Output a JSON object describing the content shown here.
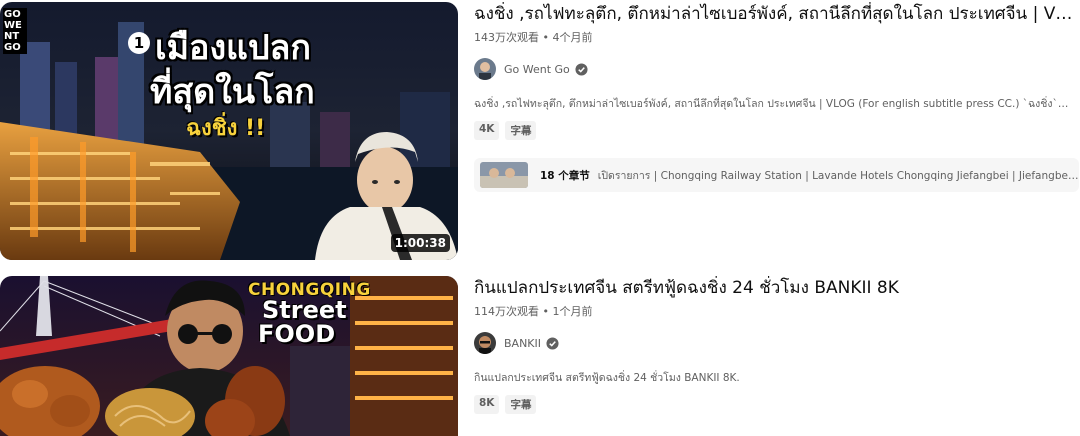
{
  "results": [
    {
      "title": "ฉงชิ่ง ,รถไฟทะลุตึก, ตึกหม่าล่าไซเบอร์พังค์, สถานีลึกที่สุดในโลก ประเทศจีน | VLOG",
      "views": "143万次观看",
      "separator": "•",
      "age": "4个月前",
      "channel": "Go Went Go",
      "verified": true,
      "description": "ฉงชิ่ง ,รถไฟทะลุตึก, ตึกหม่าล่าไซเบอร์พังค์, สถานีลึกที่สุดในโลก ประเทศจีน | VLOG (For english subtitle press CC.) `ฉงชิ่ง` ...",
      "badges": [
        "4K",
        "字幕"
      ],
      "duration": "1:00:38",
      "thumb_logo": "GO WENT GO",
      "thumb_number": "1",
      "thumb_line1": "เมืองแปลก",
      "thumb_line2": "ที่สุดในโลก",
      "thumb_line3": "ฉงชิ่ง !!",
      "chapters": {
        "count": "18 个章节",
        "list": "เปิดรายการ | Chongqing Railway Station | Lavande Hotels Chongqing Jiefangbei | Jiefangbei CBD | ..."
      }
    },
    {
      "title": "กินแปลกประเทศจีน สตรีทฟู้ดฉงชิ่ง 24 ชั่วโมง BANKII 8K",
      "views": "114万次观看",
      "separator": "•",
      "age": "1个月前",
      "channel": "BANKII",
      "verified": true,
      "description": "กินแปลกประเทศจีน สตรีทฟู้ดฉงชิ่ง 24 ชั่วโมง BANKII 8K.",
      "badges": [
        "8K",
        "字幕"
      ],
      "thumb_line1": "CHONGQING",
      "thumb_line2": "Street",
      "thumb_line3": "FOOD"
    }
  ],
  "colors": {
    "badge_bg": "#f2f2f2",
    "secondary_text": "#606060",
    "thumb_yellow": "#f7d23c"
  }
}
